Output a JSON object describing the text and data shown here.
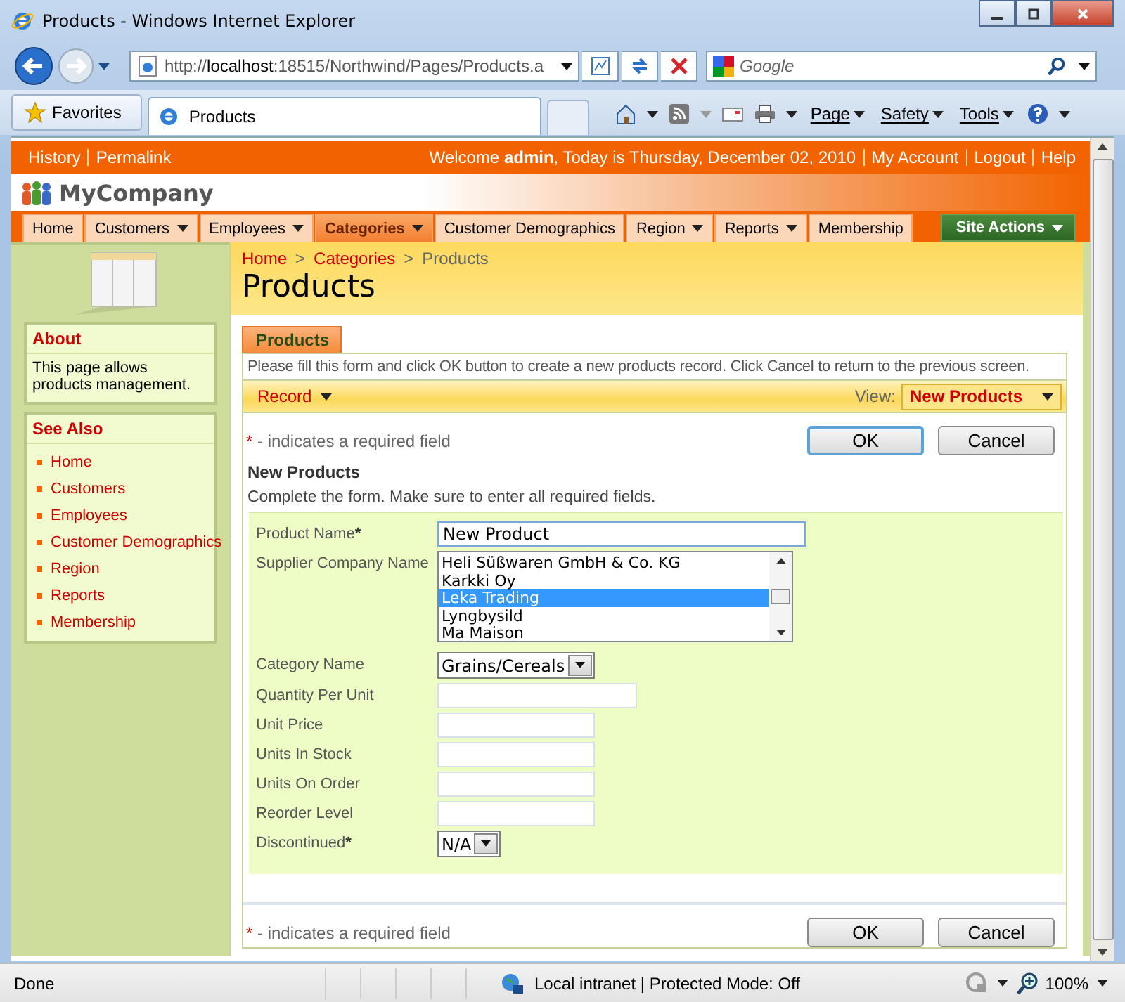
{
  "window": {
    "title": "Products - Windows Internet Explorer"
  },
  "address_bar": {
    "url": "http://**localhost**:18515/Northwind/Pages/Products.a"
  },
  "search": {
    "placeholder": "Google"
  },
  "favorites_bar": {
    "favorites": "Favorites",
    "tabs": [
      {
        "label": "Products",
        "selected": true
      }
    ]
  },
  "command_bar": {
    "menus": [
      "Page",
      "Safety",
      "Tools"
    ]
  },
  "page": {
    "top_bar": {
      "left_links": [
        "History",
        "Permalink"
      ],
      "welcome": "Welcome **admin**, Today is Thursday, December 02, 2010",
      "right_links": [
        "My Account",
        "Logout",
        "Help"
      ]
    },
    "logo": "MyCompany",
    "menu": [
      {
        "label": "Home",
        "dropdown": false,
        "selected": false
      },
      {
        "label": "Customers",
        "dropdown": true,
        "selected": false
      },
      {
        "label": "Employees",
        "dropdown": true,
        "selected": false
      },
      {
        "label": "Categories",
        "dropdown": true,
        "selected": true
      },
      {
        "label": "Customer Demographics",
        "dropdown": false,
        "selected": false
      },
      {
        "label": "Region",
        "dropdown": true,
        "selected": false
      },
      {
        "label": "Reports",
        "dropdown": true,
        "selected": false
      },
      {
        "label": "Membership",
        "dropdown": false,
        "selected": false
      }
    ],
    "site_actions": "Site Actions",
    "sidebar": {
      "about": {
        "title": "About",
        "text": "This page allows products management."
      },
      "see_also": {
        "title": "See Also",
        "links": [
          "Home",
          "Customers",
          "Employees",
          "Customer Demographics",
          "Region",
          "Reports",
          "Membership"
        ]
      }
    },
    "breadcrumb": [
      "Home",
      "Categories",
      "Products"
    ],
    "breadcrumb_separator": ">",
    "title": "Products",
    "form": {
      "tab": "Products",
      "instructions": "Please fill this form and click OK button to create a new products record. Click Cancel to return to the previous screen.",
      "record_menu": "Record",
      "view_label": "View:",
      "view_value": "New Products",
      "required_mark": "*",
      "required_note": " - indicates a required field",
      "top_buttons": [
        {
          "label": "OK",
          "focused": true
        },
        {
          "label": "Cancel",
          "focused": false
        }
      ],
      "section_title": "New Products",
      "section_text": "Complete the form. Make sure to enter all required fields.",
      "fields": [
        {
          "label": "Product Name",
          "required": true,
          "kind": "text_long",
          "value": "New Product"
        },
        {
          "label": "Supplier Company Name",
          "required": false,
          "kind": "list",
          "options": [
            {
              "label": "Heli Süßwaren GmbH & Co. KG",
              "selected": false
            },
            {
              "label": "Karkki Oy",
              "selected": false
            },
            {
              "label": "Leka Trading",
              "selected": true
            },
            {
              "label": "Lyngbysild",
              "selected": false
            },
            {
              "label": "Ma Maison",
              "selected": false
            }
          ]
        },
        {
          "label": "Category Name",
          "required": false,
          "kind": "select",
          "value": "Grains/Cereals"
        },
        {
          "label": "Quantity Per Unit",
          "required": false,
          "kind": "text_medium"
        },
        {
          "label": "Unit Price",
          "required": false,
          "kind": "text_short"
        },
        {
          "label": "Units In Stock",
          "required": false,
          "kind": "text_short"
        },
        {
          "label": "Units On Order",
          "required": false,
          "kind": "text_short"
        },
        {
          "label": "Reorder Level",
          "required": false,
          "kind": "text_short"
        },
        {
          "label": "Discontinued",
          "required": true,
          "kind": "select",
          "value": "N/A"
        }
      ],
      "bottom_required_mark": "*",
      "bottom_required_note": " - indicates a required field",
      "bottom_buttons": [
        {
          "label": "OK",
          "focused": false
        },
        {
          "label": "Cancel",
          "focused": false
        }
      ]
    }
  },
  "status_bar": {
    "text": "Done",
    "zone": "Local intranet | Protected Mode: Off",
    "zoom": "100%"
  }
}
